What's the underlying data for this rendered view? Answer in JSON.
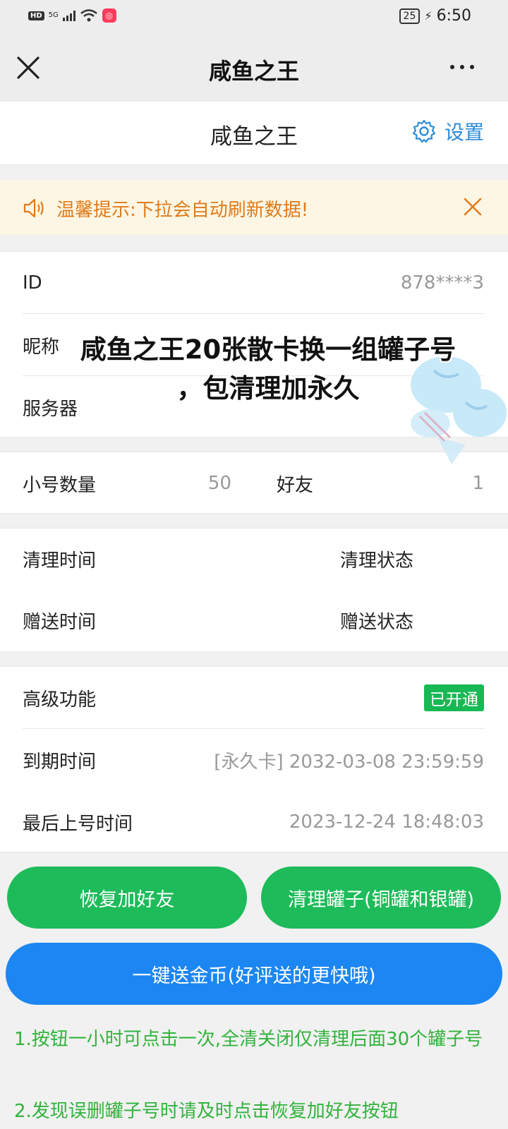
{
  "status_bar": {
    "hd": "HD",
    "network": "5G",
    "battery": "25",
    "time": "6:50",
    "icons": [
      "signal-icon",
      "wifi-icon",
      "app-badge-icon",
      "charging-bolt-icon"
    ]
  },
  "title_bar": {
    "title": "咸鱼之王",
    "close_icon": "close-icon",
    "more_icon": "more-dots-icon"
  },
  "header": {
    "title": "咸鱼之王",
    "settings_label": "设置",
    "settings_icon": "gear-icon",
    "accent_color": "#2b8cda"
  },
  "notice": {
    "text": "温馨提示:下拉会自动刷新数据!",
    "speaker_icon": "speaker-icon",
    "close_icon": "close-icon",
    "color": "#e07b1a"
  },
  "info": {
    "id_label": "ID",
    "id_value": "878****3",
    "nickname_label": "昵称",
    "server_label": "服务器"
  },
  "counts": {
    "accounts_label": "小号数量",
    "accounts_value": "50",
    "friends_label": "好友",
    "friends_value": "1"
  },
  "times": {
    "clean_time_label": "清理时间",
    "clean_status_label": "清理状态",
    "gift_time_label": "赠送时间",
    "gift_status_label": "赠送状态"
  },
  "advanced": {
    "feature_label": "高级功能",
    "feature_status": "已开通",
    "expire_label": "到期时间",
    "expire_value": "[永久卡] 2032-03-08 23:59:59",
    "last_login_label": "最后上号时间",
    "last_login_value": "2023-12-24 18:48:03",
    "status_color": "#18b954"
  },
  "overlay": {
    "line1": "咸鱼之王20张散卡换一组罐子号",
    "line2": "，包清理加永久"
  },
  "buttons": {
    "restore_friends": "恢复加好友",
    "clean_jars": "清理罐子(铜罐和银罐)",
    "send_coins": "一键送金币(好评送的更快哦)",
    "green": "#1ebb5a",
    "blue": "#1c86f2"
  },
  "tips": {
    "tip1": "1.按钮一小时可点击一次,全清关闭仅清理后面30个罐子号",
    "tip2": "2.发现误删罐子号时请及时点击恢复加好友按钮",
    "color": "#32b33c"
  }
}
